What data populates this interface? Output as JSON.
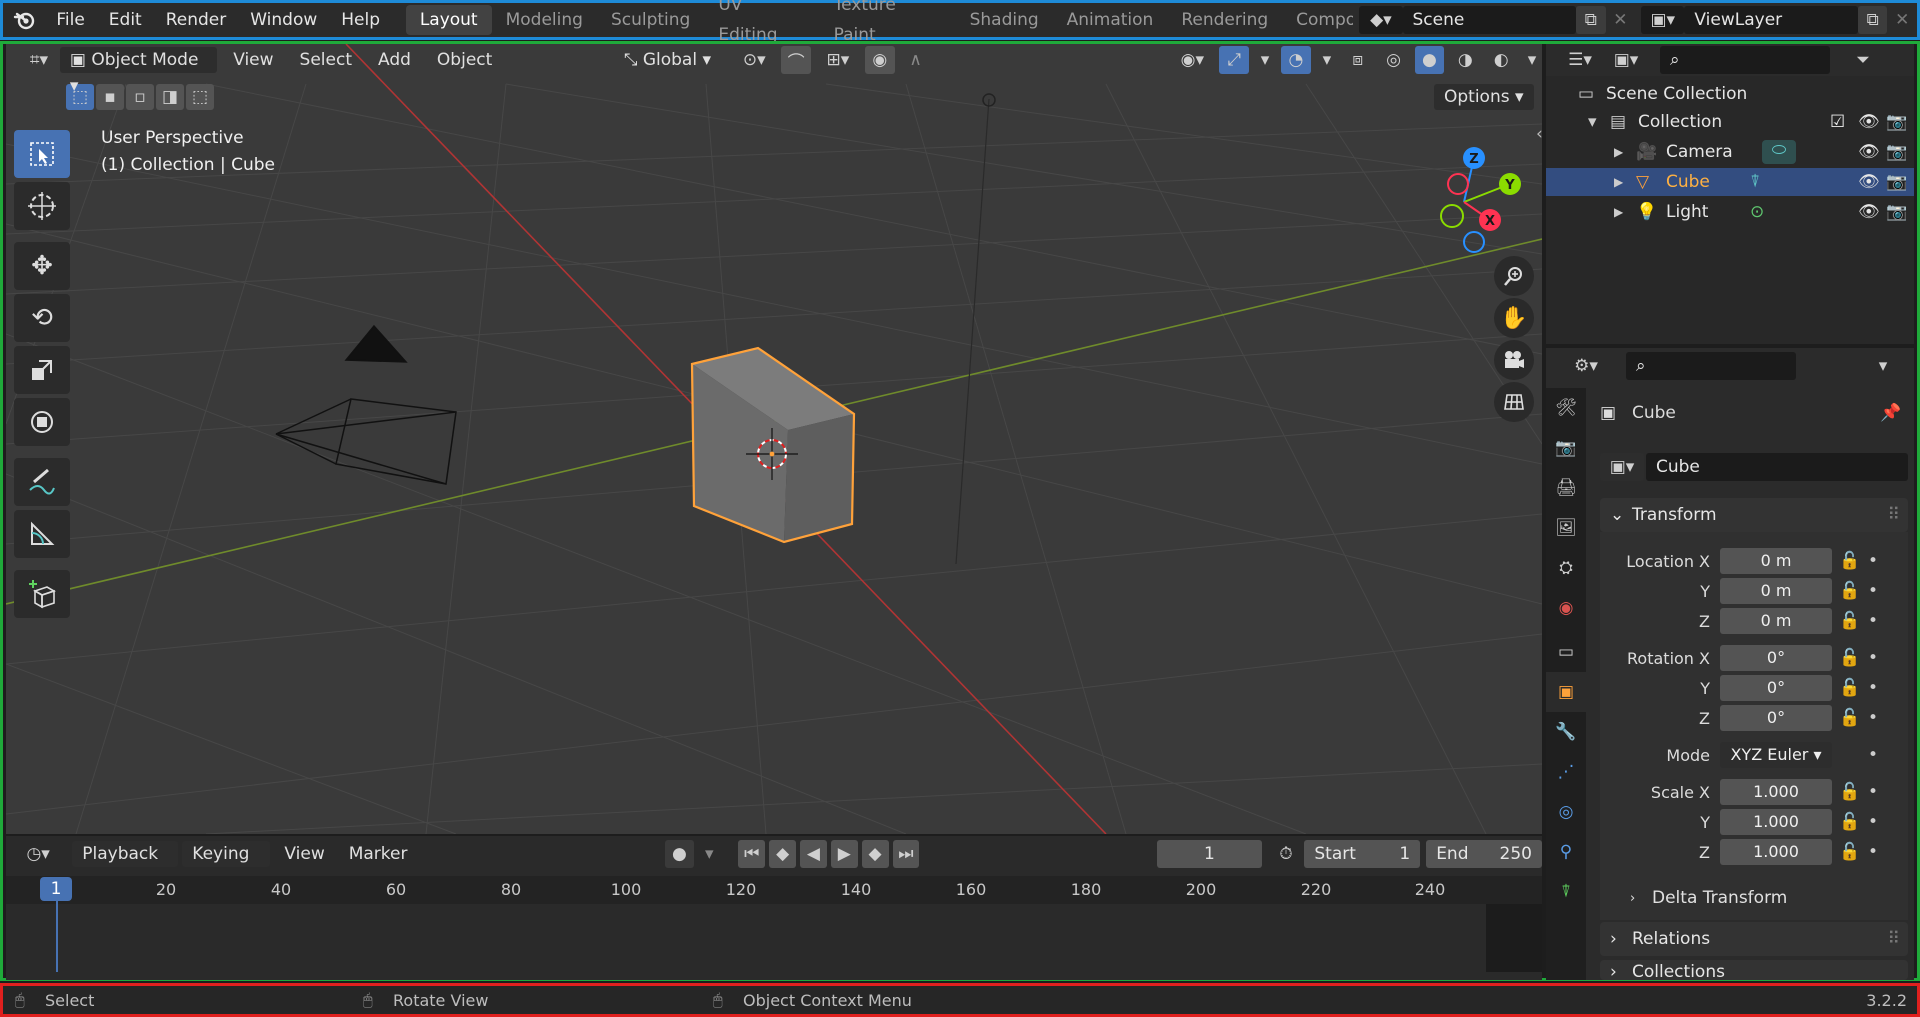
{
  "topbar": {
    "menus": [
      "File",
      "Edit",
      "Render",
      "Window",
      "Help"
    ],
    "workspaces": [
      "Layout",
      "Modeling",
      "Sculpting",
      "UV Editing",
      "Texture Paint",
      "Shading",
      "Animation",
      "Rendering",
      "Compo"
    ],
    "active_workspace": "Layout",
    "scene": "Scene",
    "view_layer": "ViewLayer"
  },
  "viewport": {
    "mode": "Object Mode",
    "menus": [
      "View",
      "Select",
      "Add",
      "Object"
    ],
    "transform_orientation": "Global",
    "options_label": "Options",
    "perspective_label": "User Perspective",
    "context_label": "(1) Collection | Cube",
    "gizmo_axes": {
      "x": "X",
      "y": "Y",
      "z": "Z"
    }
  },
  "timeline": {
    "menus": [
      "Playback",
      "Keying",
      "View",
      "Marker"
    ],
    "current_frame": "1",
    "start_label": "Start",
    "start_value": "1",
    "end_label": "End",
    "end_value": "250",
    "ruler": [
      "20",
      "40",
      "60",
      "80",
      "100",
      "120",
      "140",
      "160",
      "180",
      "200",
      "220",
      "240"
    ],
    "playhead": "1"
  },
  "outliner": {
    "root": "Scene Collection",
    "collection": "Collection",
    "items": [
      {
        "name": "Camera",
        "color": "#e0e0e0"
      },
      {
        "name": "Cube",
        "color": "#ffb142"
      },
      {
        "name": "Light",
        "color": "#e0e0e0"
      }
    ]
  },
  "properties": {
    "object_name": "Cube",
    "data_name": "Cube",
    "transform_panel": "Transform",
    "location": {
      "label": "Location X",
      "x": "0 m",
      "y": "0 m",
      "z": "0 m"
    },
    "rotation": {
      "label": "Rotation X",
      "x": "0°",
      "y": "0°",
      "z": "0°"
    },
    "mode_label": "Mode",
    "mode_value": "XYZ Euler",
    "scale": {
      "label": "Scale X",
      "x": "1.000",
      "y": "1.000",
      "z": "1.000"
    },
    "axis_y": "Y",
    "axis_z": "Z",
    "delta_panel": "Delta Transform",
    "relations_panel": "Relations",
    "collections_panel": "Collections"
  },
  "statusbar": {
    "select": "Select",
    "rotate": "Rotate View",
    "context_menu": "Object Context Menu",
    "version": "3.2.2"
  },
  "colors": {
    "accent": "#4772b3",
    "selected_orange": "#ffa23a",
    "axis_x": "#ff3352",
    "axis_y": "#8bdc00",
    "axis_z": "#2890ff"
  }
}
